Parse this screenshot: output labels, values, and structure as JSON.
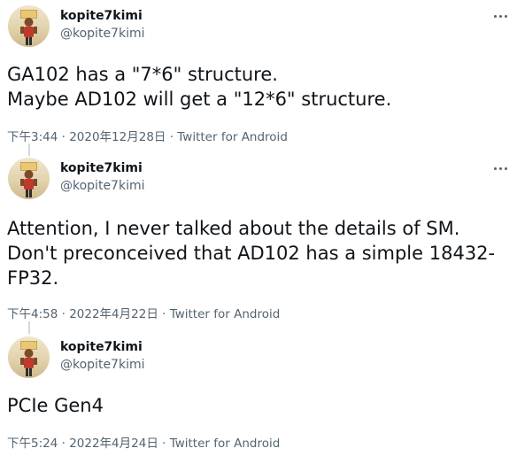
{
  "tweets": [
    {
      "user": {
        "display_name": "kopite7kimi",
        "handle": "@kopite7kimi"
      },
      "text": "GA102 has a \"7*6\" structure.\nMaybe AD102 will get a \"12*6\" structure.",
      "meta": {
        "time": "下午3:44",
        "separator1": " · ",
        "date": "2020年12月28日",
        "separator2": " · ",
        "source": "Twitter for Android"
      }
    },
    {
      "user": {
        "display_name": "kopite7kimi",
        "handle": "@kopite7kimi"
      },
      "text": "Attention, I never talked about the details of SM.\nDon't preconceived that AD102 has a simple 18432-\nFP32.",
      "meta": {
        "time": "下午4:58",
        "separator1": " · ",
        "date": "2022年4月22日",
        "separator2": " · ",
        "source": "Twitter for Android"
      }
    },
    {
      "user": {
        "display_name": "kopite7kimi",
        "handle": "@kopite7kimi"
      },
      "text": "PCIe Gen4",
      "meta": {
        "time": "下午5:24",
        "separator1": " · ",
        "date": "2022年4月24日",
        "separator2": " · ",
        "source": "Twitter for Android"
      }
    }
  ],
  "icons": {
    "more": "more-horizontal-icon",
    "avatar": "user-avatar"
  },
  "colors": {
    "primary_text": "#0f1419",
    "secondary_text": "#536471",
    "thread_line": "#cfd9de"
  }
}
